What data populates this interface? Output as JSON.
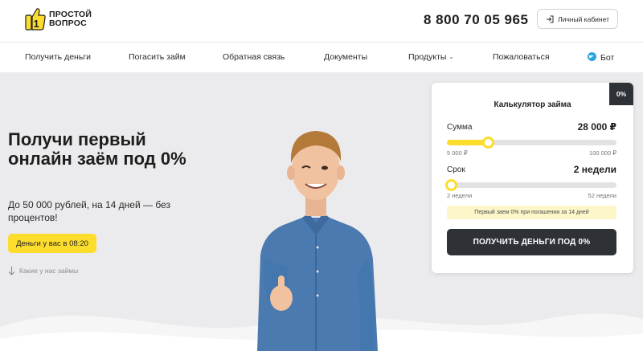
{
  "header": {
    "logo_line1": "ПРОСТОЙ",
    "logo_line2": "ВОПРОС",
    "phone": "8 800 70 05 965",
    "cabinet_label": "Личный кабинет"
  },
  "nav": {
    "items": [
      {
        "label": "Получить деньги"
      },
      {
        "label": "Погасить займ"
      },
      {
        "label": "Обратная связь"
      },
      {
        "label": "Документы"
      },
      {
        "label": "Продукты",
        "has_dropdown": true
      },
      {
        "label": "Пожаловаться"
      },
      {
        "label": "Бот",
        "icon": "telegram-icon"
      }
    ]
  },
  "hero": {
    "title": "Получи первый онлайн заём под 0%",
    "subtitle": "До 50 000 рублей, на 14 дней — без процентов!",
    "cta_label": "Деньги у вас в 08:20",
    "loans_link": "Какие у нас займы"
  },
  "calculator": {
    "badge": "0%",
    "title": "Калькулятор займа",
    "amount": {
      "label": "Сумма",
      "value_text": "28 000 ₽",
      "value": 28000,
      "min_label": "5 000 ₽",
      "max_label": "100 000 ₽",
      "min": 5000,
      "max": 100000
    },
    "term": {
      "label": "Срок",
      "value_text": "2 недели",
      "value": 2,
      "min_label": "2 недели",
      "max_label": "52 недели",
      "min": 2,
      "max": 52
    },
    "promo": "Первый заем 0% при погашении за 14 дней",
    "submit_label": "ПОЛУЧИТЬ ДЕНЬГИ ПОД 0%"
  },
  "colors": {
    "accent_yellow": "#fddd2c",
    "dark": "#2e3136",
    "hero_bg": "#ebebed",
    "telegram": "#2aa3df"
  }
}
